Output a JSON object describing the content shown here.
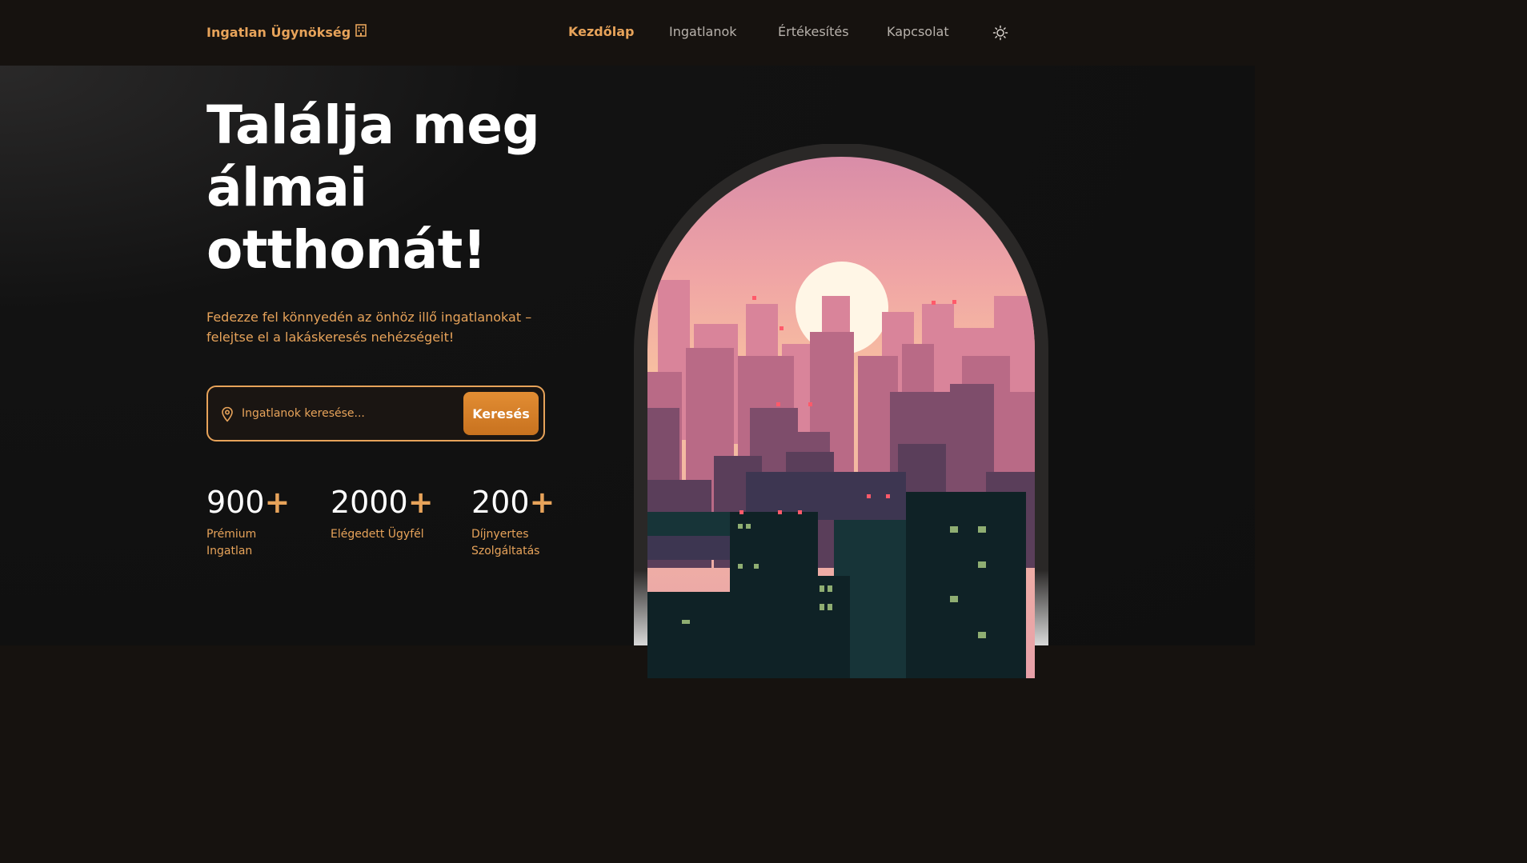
{
  "header": {
    "logo_text": "Ingatlan Ügynökség",
    "logo_icon": "building-icon",
    "nav": [
      {
        "label": "Kezdőlap",
        "active": true
      },
      {
        "label": "Ingatlanok",
        "active": false
      },
      {
        "label": "Értékesítés",
        "active": false
      },
      {
        "label": "Kapcsolat",
        "active": false
      }
    ],
    "theme_icon": "sun-icon"
  },
  "hero": {
    "title_lines": [
      "Találja meg",
      "álmai",
      "otthonát!"
    ],
    "subtitle": "Fedezze fel könnyedén az önhöz illő ingatlanokat – felejtse el a lakáskeresés nehézségeit!",
    "search": {
      "placeholder": "Ingatlanok keresése...",
      "value": "",
      "icon": "location-pin-icon",
      "button_label": "Keresés"
    },
    "stats": [
      {
        "number": "900",
        "suffix": "+",
        "label": "Prémium Ingatlan"
      },
      {
        "number": "2000",
        "suffix": "+",
        "label": "Elégedett Ügyfél"
      },
      {
        "number": "200",
        "suffix": "+",
        "label": "Díjnyertes Szolgáltatás"
      }
    ],
    "image": "pixel-art city skyline at sunset in arch frame"
  },
  "colors": {
    "accent": "#e7a35a",
    "button": "#d9822b",
    "background": "#121212",
    "header": "#16120f",
    "text": "#ffffff",
    "nav_inactive": "#b8b2ac"
  }
}
